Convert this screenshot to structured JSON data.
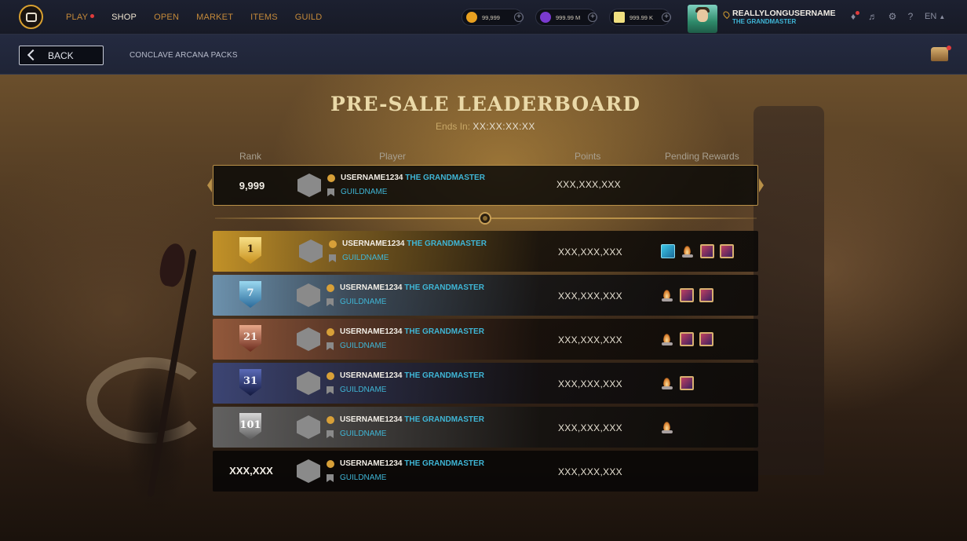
{
  "nav": {
    "items": [
      {
        "label": "PLAY",
        "dot": true
      },
      {
        "label": "SHOP",
        "active": true
      },
      {
        "label": "OPEN"
      },
      {
        "label": "MARKET"
      },
      {
        "label": "ITEMS"
      },
      {
        "label": "GUILD"
      }
    ]
  },
  "currencies": [
    {
      "icon": "gold-coin-icon",
      "value": "99,999",
      "color": "#e8a020"
    },
    {
      "icon": "purple-gem-icon",
      "value": "999.99 M",
      "color": "#7a3ad0"
    },
    {
      "icon": "ticket-icon",
      "value": "999.99 K",
      "color": "#f0e080"
    }
  ],
  "user": {
    "name": "REALLYLONGUSERNAME",
    "title": "THE GRANDMASTER"
  },
  "toolbar": {
    "help": "?",
    "language": "EN"
  },
  "subbar": {
    "back_label": "BACK",
    "breadcrumb": "CONCLAVE ARCANA PACKS"
  },
  "leaderboard": {
    "title": "PRE-SALE LEADERBOARD",
    "ends_label": "Ends In:",
    "ends_value": "XX:XX:XX:XX",
    "columns": {
      "rank": "Rank",
      "player": "Player",
      "points": "Points",
      "rewards": "Pending Rewards"
    },
    "my_entry": {
      "rank": "9,999",
      "username": "USERNAME1234",
      "title": "THE GRANDMASTER",
      "guild": "GUILDNAME",
      "points": "XXX,XXX,XXX"
    },
    "rows": [
      {
        "rank": "1",
        "tier": "gold",
        "username": "USERNAME1234",
        "title": "THE GRANDMASTER",
        "guild": "GUILDNAME",
        "points": "XXX,XXX,XXX",
        "rewards": [
          "shard-icon",
          "flame-icon",
          "card-icon",
          "card-icon"
        ]
      },
      {
        "rank": "7",
        "tier": "platinum",
        "username": "USERNAME1234",
        "title": "THE GRANDMASTER",
        "guild": "GUILDNAME",
        "points": "XXX,XXX,XXX",
        "rewards": [
          "flame-icon",
          "card-icon",
          "card-icon"
        ]
      },
      {
        "rank": "21",
        "tier": "bronze",
        "username": "USERNAME1234",
        "title": "THE GRANDMASTER",
        "guild": "GUILDNAME",
        "points": "XXX,XXX,XXX",
        "rewards": [
          "flame-icon",
          "card-icon",
          "card-icon"
        ]
      },
      {
        "rank": "31",
        "tier": "sapphire",
        "username": "USERNAME1234",
        "title": "THE GRANDMASTER",
        "guild": "GUILDNAME",
        "points": "XXX,XXX,XXX",
        "rewards": [
          "flame-icon",
          "card-icon"
        ]
      },
      {
        "rank": "101",
        "tier": "silver",
        "username": "USERNAME1234",
        "title": "THE GRANDMASTER",
        "guild": "GUILDNAME",
        "points": "XXX,XXX,XXX",
        "rewards": [
          "flame-icon"
        ]
      },
      {
        "rank": "XXX,XXX",
        "tier": "none",
        "username": "USERNAME1234",
        "title": "THE GRANDMASTER",
        "guild": "GUILDNAME",
        "points": "XXX,XXX,XXX",
        "rewards": []
      }
    ]
  },
  "colors": {
    "accent_gold": "#b89048",
    "title_cyan": "#3fb6d6",
    "notification_red": "#e23c3c"
  }
}
